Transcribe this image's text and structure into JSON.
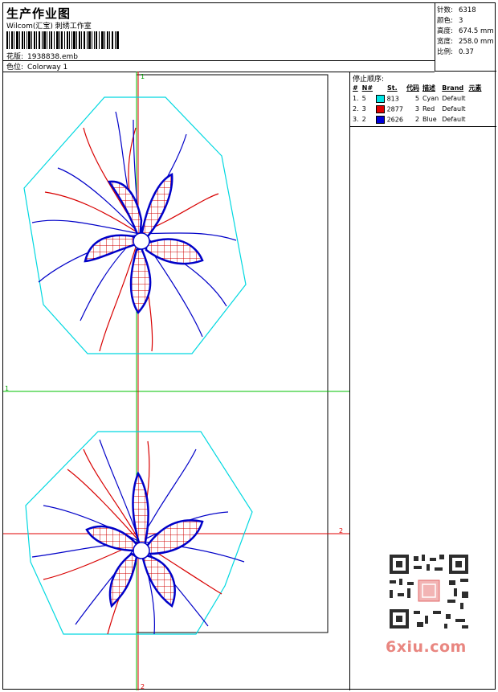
{
  "header": {
    "title": "生产作业图",
    "subtitle": "Wilcom(汇宝) 刺绣工作室",
    "design_label": "花版:",
    "design_value": "1938838.emb",
    "colorway_label": "色位:",
    "colorway_value": "Colorway 1"
  },
  "stats": [
    {
      "label": "针数:",
      "value": "6318"
    },
    {
      "label": "颜色:",
      "value": "3"
    },
    {
      "label": "高度:",
      "value": "674.5 mm"
    },
    {
      "label": "宽度:",
      "value": "258.0 mm"
    },
    {
      "label": "比例:",
      "value": "0.37"
    }
  ],
  "stops": {
    "title": "停止顺序:",
    "columns": [
      "#",
      "N#",
      "St.",
      "代码",
      "描述",
      "Brand",
      "元素"
    ],
    "rows": [
      {
        "idx": "1.",
        "n": "5",
        "swatch": "#00e5e5",
        "st": "813",
        "code": "5",
        "desc": "Cyan",
        "brand": "Default"
      },
      {
        "idx": "2.",
        "n": "3",
        "swatch": "#e00000",
        "st": "2877",
        "code": "3",
        "desc": "Red",
        "brand": "Default"
      },
      {
        "idx": "3.",
        "n": "2",
        "swatch": "#0000d8",
        "st": "2626",
        "code": "2",
        "desc": "Blue",
        "brand": "Default"
      }
    ]
  },
  "design_area": {
    "guide_labels": {
      "left_1": "1",
      "right_2": "2",
      "top_1": "1",
      "bottom_2": "2"
    },
    "colors": {
      "cyan": "#00d8e0",
      "red": "#d80000",
      "blue": "#0000c8",
      "green": "#00c000",
      "guide_red": "#e00000"
    }
  },
  "watermark": {
    "site": "6xiu.com"
  }
}
